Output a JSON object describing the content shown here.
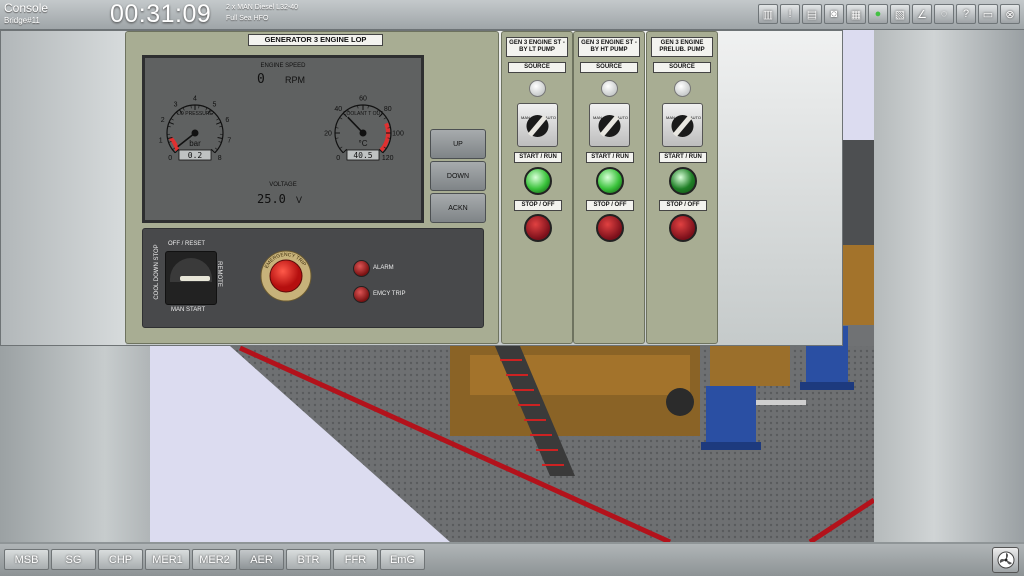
{
  "header": {
    "title": "Console",
    "station": "Bridge#11",
    "clock": "00:31:09",
    "vessel_line1": "2 x MAN Diesel L32-40",
    "vessel_line2": "Full Sea HFO",
    "tools": [
      {
        "icon": "sim-control-icon",
        "glyph": "▥"
      },
      {
        "icon": "alarm-list-icon",
        "glyph": "!"
      },
      {
        "icon": "save-icon",
        "glyph": "▤"
      },
      {
        "icon": "camera-icon",
        "glyph": "◙"
      },
      {
        "icon": "view-3d-icon",
        "glyph": "▦"
      },
      {
        "icon": "green-status-icon",
        "glyph": "●"
      },
      {
        "icon": "document-icon",
        "glyph": "▧"
      },
      {
        "icon": "trend-icon",
        "glyph": "∠"
      },
      {
        "icon": "chat-icon",
        "glyph": "◌"
      },
      {
        "icon": "help-icon",
        "glyph": "?"
      },
      {
        "icon": "print-icon",
        "glyph": "▭"
      },
      {
        "icon": "close-icon",
        "glyph": "⊗"
      }
    ]
  },
  "lop": {
    "title": "GENERATOR 3 ENGINE LOP",
    "engine_speed_label": "ENGINE SPEED",
    "engine_speed_value": "0",
    "engine_speed_unit": "RPM",
    "lo_pressure": {
      "label": "LO PRESSURE",
      "unit": "bar",
      "value": 0.2,
      "readout": "0.2",
      "min": 0,
      "max": 8,
      "ticks": [
        "0",
        "1",
        "2",
        "3",
        "4",
        "5",
        "6",
        "7",
        "8"
      ]
    },
    "coolant": {
      "label": "COOLANT T OUT",
      "unit": "°C",
      "value": 40.5,
      "readout": "40.5",
      "min": 0,
      "max": 120,
      "ticks": [
        "0",
        "20",
        "40",
        "60",
        "80",
        "100",
        "120"
      ]
    },
    "voltage_label": "VOLTAGE",
    "voltage_value": "25.0",
    "voltage_unit": "V",
    "buttons": {
      "up": "UP",
      "down": "DOWN",
      "ackn": "ACKN"
    },
    "switch_top": "OFF / RESET",
    "switch_left": "COOL DOWN STOP",
    "switch_right": "REMOTE",
    "switch_bottom": "MAN START",
    "emergency_label": "EMERGENCY TRIP",
    "alarm_label": "ALARM",
    "emcy_trip_label": "EMCY TRIP"
  },
  "pumps": [
    {
      "title": "GEN 3 ENGINE ST - BY LT PUMP",
      "source": "SOURCE",
      "man": "MAN",
      "auto": "AUTO",
      "start": "START / RUN",
      "stop": "STOP / OFF",
      "running_color": "#39c23a"
    },
    {
      "title": "GEN 3 ENGINE ST - BY HT PUMP",
      "source": "SOURCE",
      "man": "MAN",
      "auto": "AUTO",
      "start": "START / RUN",
      "stop": "STOP / OFF",
      "running_color": "#39c23a"
    },
    {
      "title": "GEN 3 ENGINE PRELUB. PUMP",
      "source": "SOURCE",
      "man": "MAN",
      "auto": "AUTO",
      "start": "START / RUN",
      "stop": "STOP / OFF",
      "running_color": "#1f7f26"
    }
  ],
  "tabs": [
    {
      "label": "MSB",
      "active": false
    },
    {
      "label": "SG",
      "active": false
    },
    {
      "label": "CHP",
      "active": false
    },
    {
      "label": "MER1",
      "active": false
    },
    {
      "label": "MER2",
      "active": false
    },
    {
      "label": "AER",
      "active": true
    },
    {
      "label": "BTR",
      "active": false
    },
    {
      "label": "FFR",
      "active": false
    },
    {
      "label": "EmG",
      "active": false
    }
  ],
  "fan_icon": "fan-icon",
  "colors": {
    "panel": "#a8ad93",
    "screen": "#5f6161",
    "floor_edge": "#b3121b",
    "pump_blue": "#2a4fa3",
    "engine": "#a3732b"
  }
}
